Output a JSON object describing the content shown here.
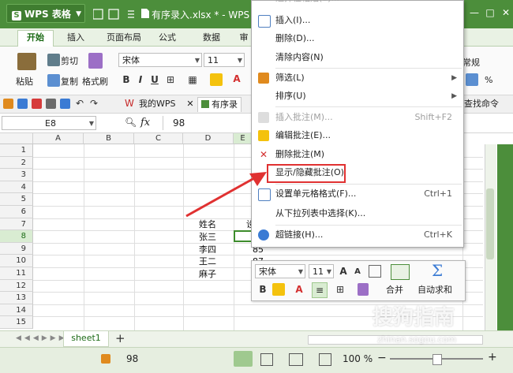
{
  "window": {
    "app_button": "WPS 表格",
    "doc_title": "有序录入.xlsx * - WPS",
    "accent": "#4c8e3b",
    "minimize_icon": "minimize-icon",
    "restore_icon": "restore-icon",
    "close_icon": "close-icon"
  },
  "tabs": [
    "开始",
    "插入",
    "页面布局",
    "公式",
    "数据",
    "审"
  ],
  "ribbon": {
    "paste": "粘贴",
    "cut": "剪切",
    "copy": "复制",
    "format_painter": "格式刷",
    "font_name": "宋体",
    "font_size": "11",
    "conditional_format_fragment": "常规",
    "percent": "%",
    "find_command": "查找命令"
  },
  "quickbar": {
    "mywps_tab": "我的WPS",
    "doc_tab": "有序录"
  },
  "formula_bar": {
    "name_box": "E8",
    "fx": "fx",
    "value": "98"
  },
  "columns": [
    "A",
    "B",
    "C",
    "D",
    "E"
  ],
  "rows": [
    "1",
    "2",
    "3",
    "4",
    "5",
    "6",
    "7",
    "8",
    "9",
    "10",
    "11",
    "12",
    "13",
    "14",
    "15"
  ],
  "cells": {
    "d7": "姓名",
    "d8": "张三",
    "d9": "李四",
    "d10": "王二",
    "d11": "麻子",
    "e7": "设",
    "e9": "85",
    "e10": "87"
  },
  "context_menu": {
    "items": [
      {
        "label": "插入(I)...",
        "shortcut": "",
        "icon": "insert-icon"
      },
      {
        "label": "删除(D)...",
        "shortcut": "",
        "icon": ""
      },
      {
        "label": "清除内容(N)",
        "shortcut": "",
        "icon": ""
      },
      {
        "label": "筛选(L)",
        "shortcut": "",
        "icon": "filter-icon",
        "submenu": true
      },
      {
        "label": "排序(U)",
        "shortcut": "",
        "icon": "",
        "submenu": true
      },
      {
        "label": "插入批注(M)...",
        "shortcut": "Shift+F2",
        "icon": "insert-comment-icon",
        "disabled": true
      },
      {
        "label": "编辑批注(E)...",
        "shortcut": "",
        "icon": "edit-comment-icon"
      },
      {
        "label": "删除批注(M)",
        "shortcut": "",
        "icon": "delete-comment-icon"
      },
      {
        "label": "显示/隐藏批注(O)",
        "shortcut": "",
        "icon": "",
        "highlighted": true
      },
      {
        "label": "设置单元格格式(F)...",
        "shortcut": "Ctrl+1",
        "icon": "format-cells-icon"
      },
      {
        "label": "从下拉列表中选择(K)...",
        "shortcut": "",
        "icon": ""
      },
      {
        "label": "超链接(H)...",
        "shortcut": "Ctrl+K",
        "icon": "hyperlink-icon"
      }
    ],
    "top_partial": "选择性粘贴(S)..."
  },
  "mini_toolbar": {
    "font_name": "宋体",
    "font_size": "11",
    "merge": "合并",
    "autosum": "自动求和"
  },
  "sheet": {
    "tab": "sheet1",
    "add": "+"
  },
  "status": {
    "value": "98",
    "zoom": "100 %",
    "minus": "−",
    "plus": "+"
  },
  "watermark": {
    "brand": "搜狗指南",
    "url": "zhinan.sogou.com"
  }
}
